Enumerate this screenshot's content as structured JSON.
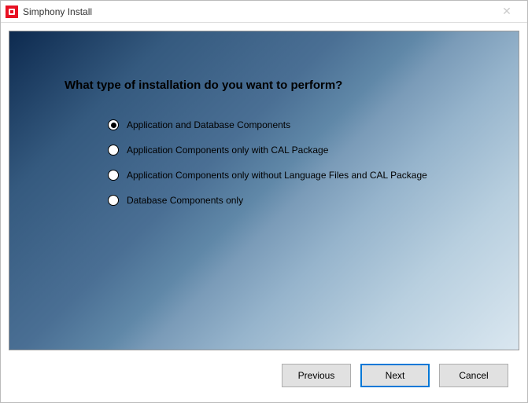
{
  "window": {
    "title": "Simphony Install"
  },
  "main": {
    "heading": "What type of installation do you want to perform?",
    "options": [
      {
        "label": "Application and Database Components",
        "selected": true
      },
      {
        "label": "Application Components only with CAL Package",
        "selected": false
      },
      {
        "label": "Application Components only without Language Files and CAL Package",
        "selected": false
      },
      {
        "label": "Database Components only",
        "selected": false
      }
    ]
  },
  "buttons": {
    "previous": "Previous",
    "next": "Next",
    "cancel": "Cancel"
  }
}
